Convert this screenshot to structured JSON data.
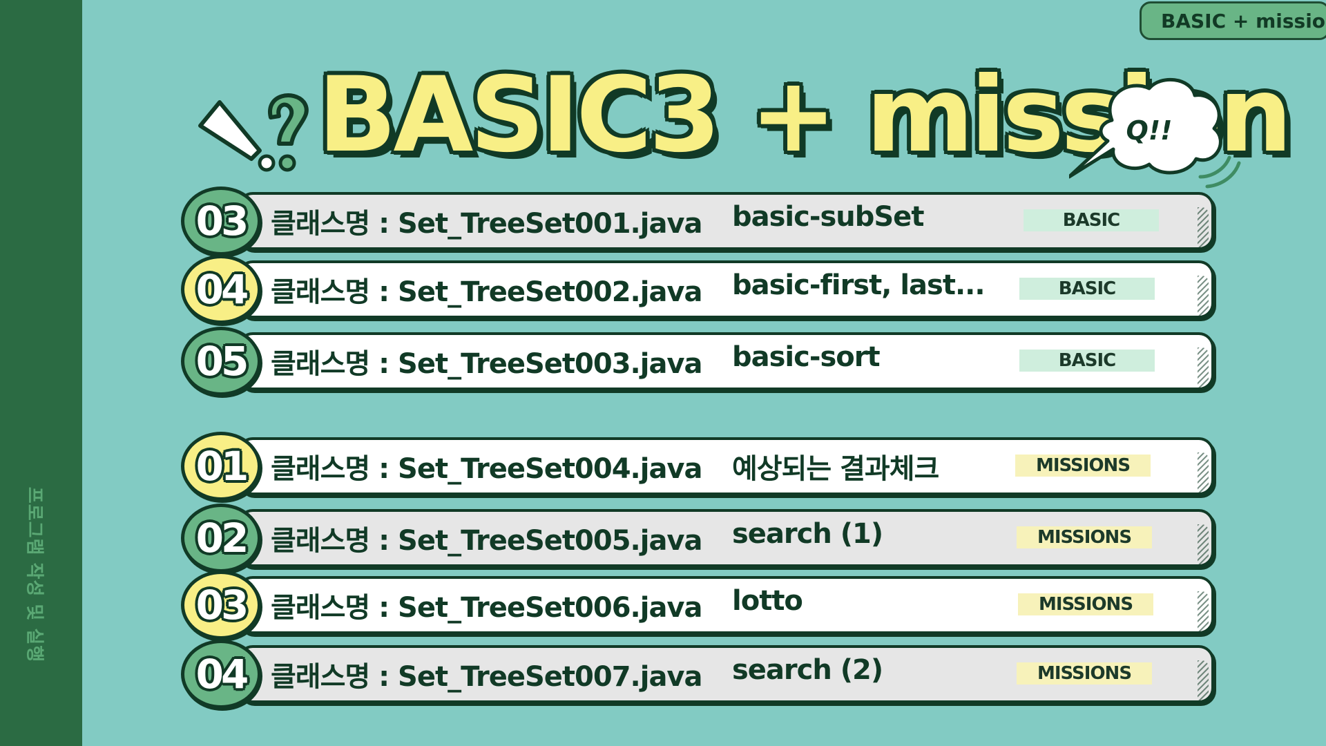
{
  "sidebar": {
    "vertical_text": "프로그램 작성 및 실행"
  },
  "corner_tag": {
    "label": "BASIC + mission"
  },
  "title": {
    "text": "BASIC3 + mission",
    "bubble_text": "Q!!"
  },
  "colors": {
    "background": "#82cbc3",
    "sidebar": "#2b6b43",
    "accent_yellow": "#f8ef86",
    "accent_green": "#69b586",
    "outline": "#113a26"
  },
  "rows": [
    {
      "number": "03",
      "badge_color": "green",
      "bar": "gray",
      "class_label": "클래스명 : Set_TreeSet001.java",
      "desc": "basic-subSet",
      "tag": "BASIC",
      "tag_type": "basic"
    },
    {
      "number": "04",
      "badge_color": "yellow",
      "bar": "white",
      "class_label": "클래스명 : Set_TreeSet002.java",
      "desc": "basic-first, last...",
      "tag": "BASIC",
      "tag_type": "basic"
    },
    {
      "number": "05",
      "badge_color": "green",
      "bar": "white",
      "class_label": "클래스명 : Set_TreeSet003.java",
      "desc": "basic-sort",
      "tag": "BASIC",
      "tag_type": "basic"
    },
    {
      "number": "01",
      "badge_color": "yellow",
      "bar": "white",
      "class_label": "클래스명 : Set_TreeSet004.java",
      "desc": "예상되는 결과체크",
      "tag": "MISSIONS",
      "tag_type": "mission"
    },
    {
      "number": "02",
      "badge_color": "green",
      "bar": "gray",
      "class_label": "클래스명 : Set_TreeSet005.java",
      "desc": "search (1)",
      "tag": "MISSIONS",
      "tag_type": "mission"
    },
    {
      "number": "03",
      "badge_color": "yellow",
      "bar": "white",
      "class_label": "클래스명 : Set_TreeSet006.java",
      "desc": "lotto",
      "tag": "MISSIONS",
      "tag_type": "mission"
    },
    {
      "number": "04",
      "badge_color": "green",
      "bar": "gray",
      "class_label": "클래스명 : Set_TreeSet007.java",
      "desc": "search (2)",
      "tag": "MISSIONS",
      "tag_type": "mission"
    }
  ]
}
